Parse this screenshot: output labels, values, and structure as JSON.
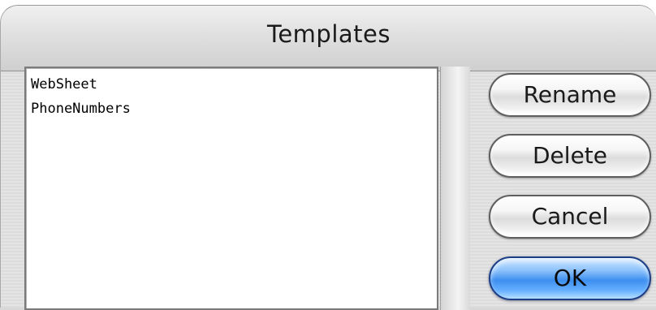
{
  "dialog": {
    "title": "Templates"
  },
  "templates": {
    "items": [
      {
        "label": "WebSheet"
      },
      {
        "label": "PhoneNumbers"
      }
    ]
  },
  "buttons": {
    "rename": "Rename",
    "delete": "Delete",
    "cancel": "Cancel",
    "ok": "OK"
  },
  "colors": {
    "default_button": "#3d8ff0",
    "button_border": "#5e5e5e"
  }
}
